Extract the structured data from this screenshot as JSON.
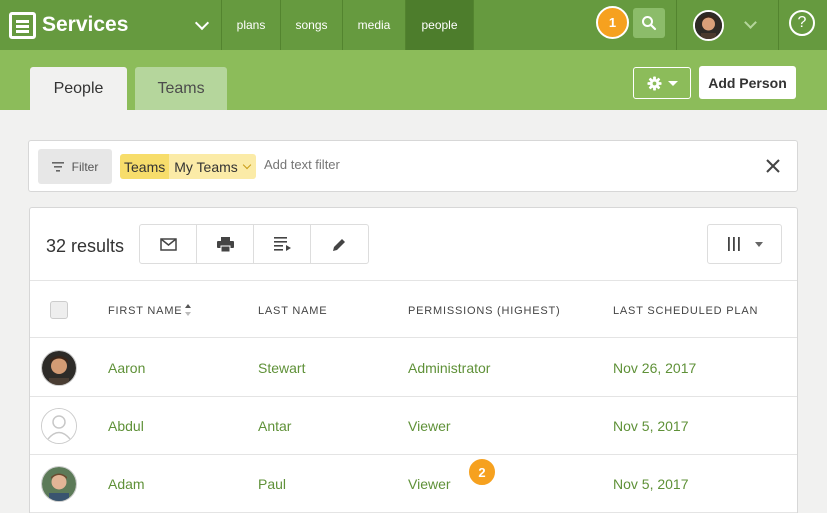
{
  "app": {
    "name": "Services",
    "nav_tabs": [
      {
        "label": "plans"
      },
      {
        "label": "songs"
      },
      {
        "label": "media"
      },
      {
        "label": "people"
      }
    ],
    "notification_badge": "1",
    "help_label": "?"
  },
  "tabs": [
    {
      "label": "People"
    },
    {
      "label": "Teams"
    }
  ],
  "toolbar": {
    "add_label": "Add Person"
  },
  "filter": {
    "button_label": "Filter",
    "chip_key": "Teams",
    "chip_value": "My Teams",
    "placeholder": "Add text filter"
  },
  "results": {
    "count_label": "32 results"
  },
  "table": {
    "columns": [
      "FIRST NAME",
      "LAST NAME",
      "PERMISSIONS (HIGHEST)",
      "LAST SCHEDULED PLAN"
    ],
    "rows": [
      {
        "first": "Aaron",
        "last": "Stewart",
        "permission": "Administrator",
        "last_plan": "Nov 26, 2017"
      },
      {
        "first": "Abdul",
        "last": "Antar",
        "permission": "Viewer",
        "last_plan": "Nov 5, 2017"
      },
      {
        "first": "Adam",
        "last": "Paul",
        "permission": "Viewer",
        "last_plan": "Nov 5, 2017"
      }
    ]
  },
  "hint_badge": "2",
  "colors": {
    "topbar": "#669a3f",
    "subbar": "#8cbc5a",
    "accent_green": "#5f9138",
    "badge": "#f6a11f"
  },
  "icons": [
    "services-logo-icon",
    "chevron-down-icon",
    "search-icon",
    "gear-icon",
    "help-icon",
    "filter-icon",
    "close-icon",
    "email-icon",
    "print-icon",
    "list-icon",
    "edit-icon",
    "columns-icon",
    "sort-icon",
    "avatar-placeholder-icon"
  ]
}
